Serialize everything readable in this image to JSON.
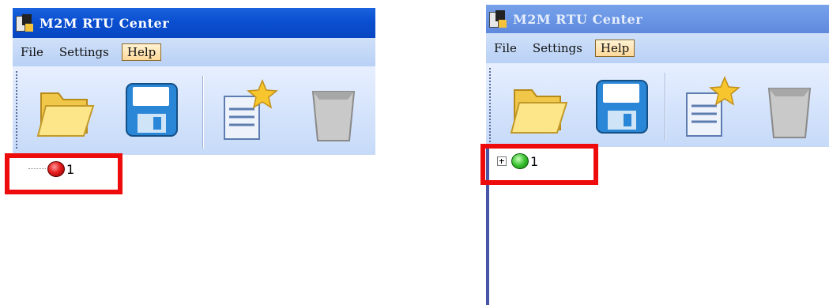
{
  "left": {
    "title": "M2M RTU Center",
    "menu": [
      "File",
      "Settings",
      "Help"
    ],
    "active_menu_index": 2,
    "tree": {
      "label": "1",
      "status": "red"
    }
  },
  "right": {
    "title": "M2M RTU Center",
    "menu": [
      "File",
      "Settings",
      "Help"
    ],
    "active_menu_index": 2,
    "tree": {
      "label": "1",
      "status": "green"
    }
  },
  "icons": [
    "open-folder-icon",
    "save-disk-icon",
    "new-document-icon",
    "delete-trash-icon"
  ],
  "colors": {
    "highlight": "#ee0b0b",
    "titlebar_active": "#0a4fd0",
    "titlebar_inactive": "#6a96e5"
  }
}
